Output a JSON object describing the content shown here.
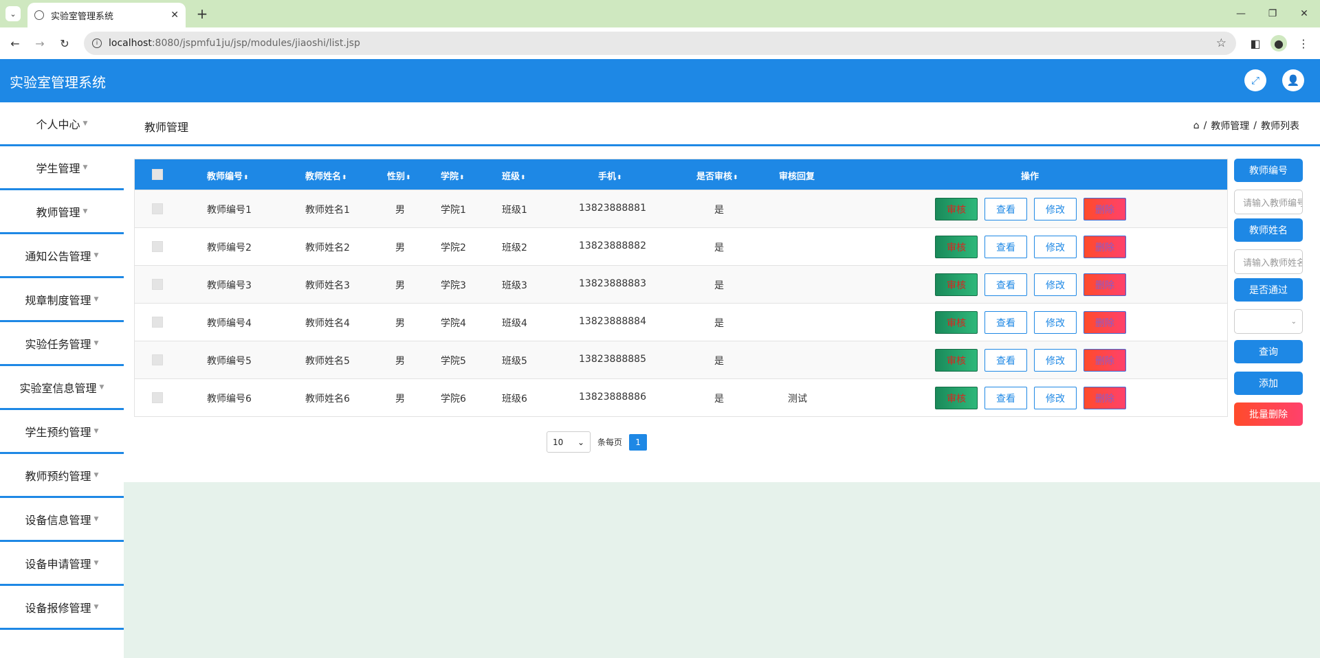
{
  "browser": {
    "tab_title": "实验室管理系统",
    "url_host": "localhost",
    "url_path": ":8080/jspmfu1ju/jsp/modules/jiaoshi/list.jsp"
  },
  "app": {
    "title": "实验室管理系统"
  },
  "sidebar": {
    "items": [
      {
        "label": "个人中心"
      },
      {
        "label": "学生管理"
      },
      {
        "label": "教师管理"
      },
      {
        "label": "通知公告管理"
      },
      {
        "label": "规章制度管理"
      },
      {
        "label": "实验任务管理"
      },
      {
        "label": "实验室信息管理"
      },
      {
        "label": "学生预约管理"
      },
      {
        "label": "教师预约管理"
      },
      {
        "label": "设备信息管理"
      },
      {
        "label": "设备申请管理"
      },
      {
        "label": "设备报修管理"
      }
    ]
  },
  "page": {
    "title": "教师管理",
    "breadcrumb": [
      "教师管理",
      "教师列表"
    ]
  },
  "table": {
    "headers": {
      "code": "教师编号",
      "name": "教师姓名",
      "gender": "性别",
      "college": "学院",
      "class": "班级",
      "phone": "手机",
      "audited": "是否审核",
      "reply": "审核回复",
      "actions": "操作"
    },
    "rows": [
      {
        "code": "教师编号1",
        "name": "教师姓名1",
        "gender": "男",
        "college": "学院1",
        "class": "班级1",
        "phone": "13823888881",
        "audited": "是",
        "reply": ""
      },
      {
        "code": "教师编号2",
        "name": "教师姓名2",
        "gender": "男",
        "college": "学院2",
        "class": "班级2",
        "phone": "13823888882",
        "audited": "是",
        "reply": ""
      },
      {
        "code": "教师编号3",
        "name": "教师姓名3",
        "gender": "男",
        "college": "学院3",
        "class": "班级3",
        "phone": "13823888883",
        "audited": "是",
        "reply": ""
      },
      {
        "code": "教师编号4",
        "name": "教师姓名4",
        "gender": "男",
        "college": "学院4",
        "class": "班级4",
        "phone": "13823888884",
        "audited": "是",
        "reply": ""
      },
      {
        "code": "教师编号5",
        "name": "教师姓名5",
        "gender": "男",
        "college": "学院5",
        "class": "班级5",
        "phone": "13823888885",
        "audited": "是",
        "reply": ""
      },
      {
        "code": "教师编号6",
        "name": "教师姓名6",
        "gender": "男",
        "college": "学院6",
        "class": "班级6",
        "phone": "13823888886",
        "audited": "是",
        "reply": "测试"
      }
    ],
    "row_buttons": {
      "audit": "审核",
      "view": "查看",
      "edit": "修改",
      "delete": "删除"
    }
  },
  "pager": {
    "page_size": "10",
    "per_page_label": "条每页",
    "current_page": "1"
  },
  "search": {
    "code_label": "教师编号",
    "code_placeholder": "请输入教师编号",
    "name_label": "教师姓名",
    "name_placeholder": "请输入教师姓名",
    "pass_label": "是否通过",
    "query": "查询",
    "add": "添加",
    "batch_delete": "批量删除"
  },
  "colors": {
    "primary": "#1e88e5",
    "browser_frame": "#cfe8c0",
    "page_bg": "#e6f2eb"
  }
}
